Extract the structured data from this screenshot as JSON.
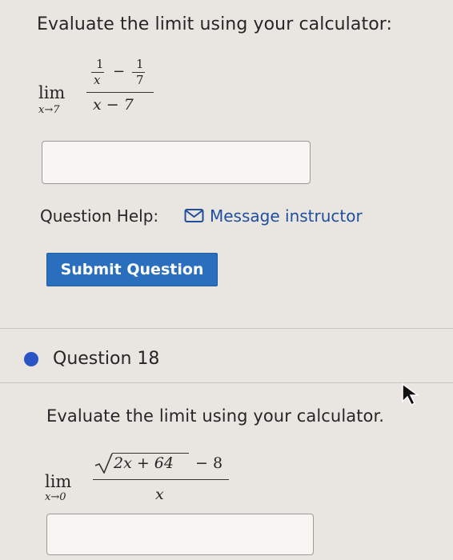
{
  "question1": {
    "prompt": "Evaluate the limit using your calculator:",
    "limit": {
      "lim": "lim",
      "approach": "x→7",
      "num_frac1_top": "1",
      "num_frac1_bottom": "x",
      "num_minus": "−",
      "num_frac2_top": "1",
      "num_frac2_bottom": "7",
      "denominator": "x − 7"
    },
    "answer_value": ""
  },
  "help": {
    "label": "Question Help:",
    "message_link": "Message instructor"
  },
  "submit_label": "Submit Question",
  "question18": {
    "title": "Question 18",
    "prompt": "Evaluate the limit using your calculator.",
    "limit": {
      "lim": "lim",
      "approach": "x→0",
      "radicand": "2x + 64",
      "minus_part": "− 8",
      "denominator": "x"
    },
    "answer_value": ""
  },
  "colors": {
    "accent": "#2a6fbe",
    "bullet": "#2a55c4",
    "link": "#1e4e9c"
  },
  "icons": [
    "envelope-icon",
    "mouse-cursor-icon"
  ]
}
